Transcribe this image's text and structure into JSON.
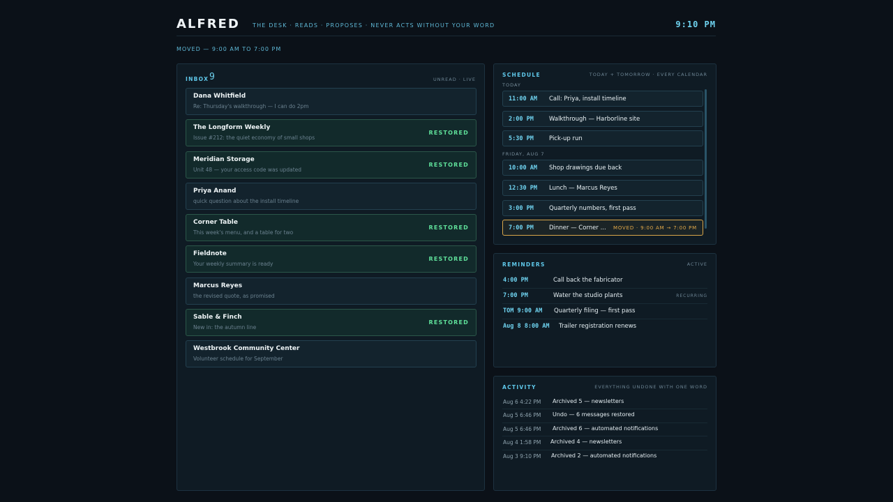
{
  "header": {
    "brand": "ALFRED",
    "tagline": "THE DESK · READS · PROPOSES · NEVER ACTS WITHOUT YOUR WORD",
    "clock": "9:10 PM",
    "status": "MOVED — 9:00 AM TO 7:00 PM"
  },
  "inbox": {
    "title": "INBOX",
    "count": "9",
    "meta": "UNREAD · LIVE",
    "items": [
      {
        "from": "Dana Whitfield",
        "subject": "Re: Thursday's walkthrough — I can do 2pm",
        "badge": ""
      },
      {
        "from": "The Longform Weekly",
        "subject": "Issue #212: the quiet economy of small shops",
        "badge": "RESTORED"
      },
      {
        "from": "Meridian Storage",
        "subject": "Unit 48 — your access code was updated",
        "badge": "RESTORED"
      },
      {
        "from": "Priya Anand",
        "subject": "quick question about the install timeline",
        "badge": ""
      },
      {
        "from": "Corner Table",
        "subject": "This week's menu, and a table for two",
        "badge": "RESTORED"
      },
      {
        "from": "Fieldnote",
        "subject": "Your weekly summary is ready",
        "badge": "RESTORED"
      },
      {
        "from": "Marcus Reyes",
        "subject": "the revised quote, as promised",
        "badge": ""
      },
      {
        "from": "Sable & Finch",
        "subject": "New in: the autumn line",
        "badge": "RESTORED"
      },
      {
        "from": "Westbrook Community Center",
        "subject": "Volunteer schedule for September",
        "badge": ""
      }
    ]
  },
  "schedule": {
    "title": "SCHEDULE",
    "meta": "TODAY + TOMORROW · EVERY CALENDAR",
    "days": [
      {
        "label": "TODAY",
        "events": [
          {
            "time": "11:00 AM",
            "title": "Call: Priya, install timeline",
            "note": ""
          },
          {
            "time": "2:00 PM",
            "title": "Walkthrough — Harborline site",
            "note": ""
          },
          {
            "time": "5:30 PM",
            "title": "Pick-up run",
            "note": ""
          }
        ]
      },
      {
        "label": "FRIDAY, AUG 7",
        "events": [
          {
            "time": "10:00 AM",
            "title": "Shop drawings due back",
            "note": ""
          },
          {
            "time": "12:30 PM",
            "title": "Lunch — Marcus Reyes",
            "note": ""
          },
          {
            "time": "3:00 PM",
            "title": "Quarterly numbers, first pass",
            "note": ""
          },
          {
            "time": "7:00 PM",
            "title": "Dinner — Corner ...",
            "note": "MOVED · 9:00 AM → 7:00 PM"
          }
        ]
      }
    ]
  },
  "reminders": {
    "title": "REMINDERS",
    "meta": "ACTIVE",
    "items": [
      {
        "time": "4:00 PM",
        "text": "Call back the fabricator",
        "tag": ""
      },
      {
        "time": "7:00 PM",
        "text": "Water the studio plants",
        "tag": "RECURRING"
      },
      {
        "time": "TOM 9:00 AM",
        "text": "Quarterly filing — first pass",
        "tag": ""
      },
      {
        "time": "Aug 8 8:00 AM",
        "text": "Trailer registration renews",
        "tag": ""
      }
    ]
  },
  "activity": {
    "title": "ACTIVITY",
    "meta": "EVERYTHING UNDONE WITH ONE WORD",
    "items": [
      {
        "time": "Aug 6 4:22 PM",
        "text": "Archived 5 — newsletters"
      },
      {
        "time": "Aug 5 6:46 PM",
        "text": "Undo — 6 messages restored"
      },
      {
        "time": "Aug 5 6:46 PM",
        "text": "Archived 6 — automated notifications"
      },
      {
        "time": "Aug 4 1:58 PM",
        "text": "Archived 4 — newsletters"
      },
      {
        "time": "Aug 3 9:10 PM",
        "text": "Archived 2 — automated notifications"
      }
    ]
  },
  "colors": {
    "accent": "#6fd3f0",
    "restored": "#5fe09a",
    "moved": "#e3aa4a",
    "background": "#0b1118"
  }
}
